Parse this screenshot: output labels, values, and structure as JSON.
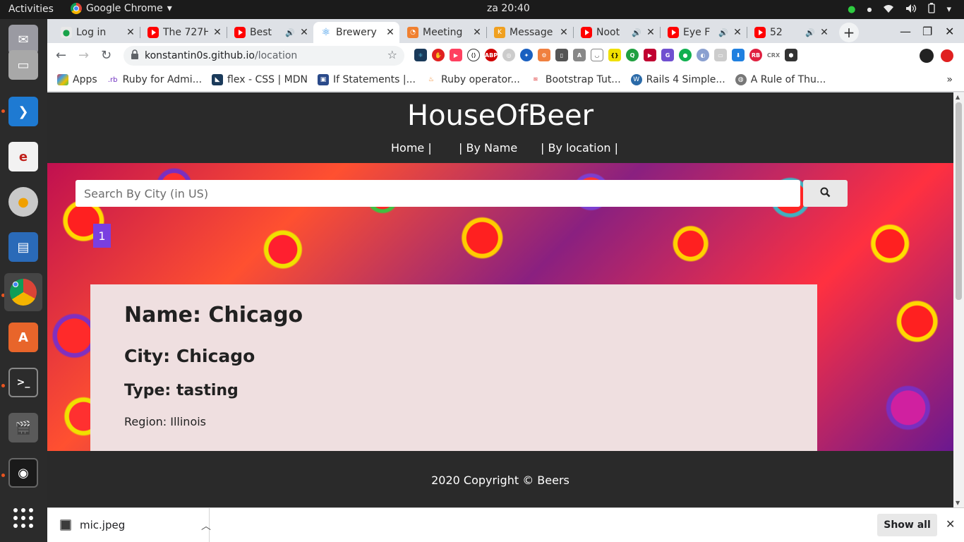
{
  "topbar": {
    "activities": "Activities",
    "app_name": "Google Chrome",
    "clock": "za 20:40"
  },
  "tabs": [
    {
      "title": "Log in",
      "favicon": "leaf-icon",
      "audio": false
    },
    {
      "title": "The 727H",
      "favicon": "youtube-icon",
      "audio": false
    },
    {
      "title": "Best",
      "favicon": "youtube-icon",
      "audio": true
    },
    {
      "title": "Brewery",
      "favicon": "react-icon",
      "audio": false,
      "active": true
    },
    {
      "title": "Meeting",
      "favicon": "meeting-icon",
      "audio": false
    },
    {
      "title": "Message",
      "favicon": "k-icon",
      "audio": false
    },
    {
      "title": "Noot",
      "favicon": "youtube-icon",
      "audio": true
    },
    {
      "title": "Eye F",
      "favicon": "youtube-icon",
      "audio": true
    },
    {
      "title": "52",
      "favicon": "youtube-icon",
      "audio": true
    }
  ],
  "address_bar": {
    "host": "konstantin0s.github.io",
    "path": "/location"
  },
  "bookmarks": [
    {
      "label": "Apps",
      "icon": "apps-grid-icon"
    },
    {
      "label": "Ruby for Admi...",
      "icon": "rb-icon"
    },
    {
      "label": "flex - CSS | MDN",
      "icon": "mdn-icon"
    },
    {
      "label": "If Statements |...",
      "icon": "bookmark-icon"
    },
    {
      "label": "Ruby operator...",
      "icon": "flame-icon"
    },
    {
      "label": "Bootstrap Tut...",
      "icon": "w3-icon"
    },
    {
      "label": "Rails 4 Simple...",
      "icon": "wordpress-icon"
    },
    {
      "label": "A Rule of Thu...",
      "icon": "globe-icon"
    }
  ],
  "site": {
    "title": "HouseOfBeer",
    "nav": [
      "Home |",
      "| By Name",
      "| By location |"
    ],
    "search_placeholder": "Search By City (in US)",
    "page_number": "1",
    "card": {
      "name": "Name: Chicago",
      "city": "City: Chicago",
      "type": "Type: tasting",
      "region": "Region: Illinois"
    },
    "footer": "2020 Copyright © Beers"
  },
  "downloads": {
    "file_name": "mic.jpeg",
    "show_all": "Show all"
  },
  "colors": {
    "page_badge": "#7a3fe0",
    "card_bg": "#efdfe0",
    "site_dark": "#2a2a2a"
  }
}
